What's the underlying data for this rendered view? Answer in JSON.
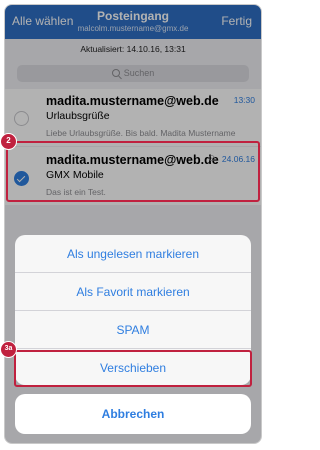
{
  "nav": {
    "left_button": "Alle wählen",
    "title": "Posteingang",
    "account": "malcolm.mustername@gmx.de",
    "right_button": "Fertig"
  },
  "updated": "Aktualisiert: 14.10.16, 13:31",
  "search": {
    "placeholder": "Suchen"
  },
  "mails": [
    {
      "sender": "madita.mustername@web.de",
      "subject": "Urlaubsgrüße",
      "preview": "Liebe Urlaubsgrüße. Bis bald. Madita Mustername",
      "date": "13:30",
      "selected": false,
      "attachment": false
    },
    {
      "sender": "madita.mustername@web.de",
      "subject": "GMX Mobile",
      "preview": "Das ist ein Test.",
      "date": "24.06.16",
      "selected": true,
      "attachment": true
    }
  ],
  "callouts": [
    "2",
    "3a"
  ],
  "actions": {
    "items": [
      "Als ungelesen markieren",
      "Als Favorit markieren",
      "SPAM",
      "Verschieben"
    ],
    "cancel": "Abbrechen"
  },
  "colors": {
    "nav_blue": "#2f6fc4",
    "link_blue": "#2f7ee0",
    "highlight_red": "#c0213f"
  }
}
